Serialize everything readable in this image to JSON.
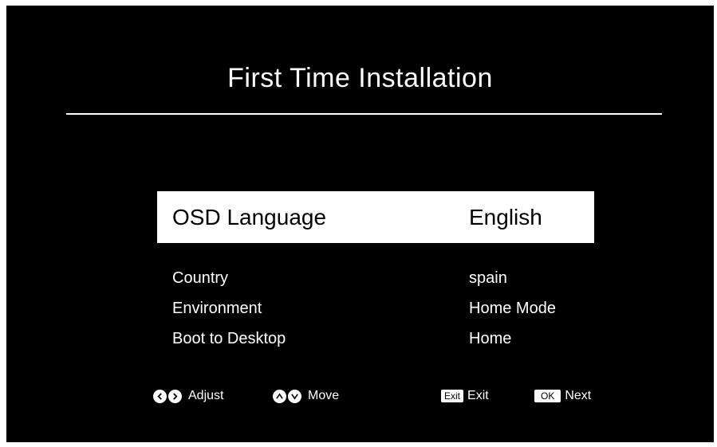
{
  "title": "First Time Installation",
  "menu": {
    "items": [
      {
        "label": "OSD Language",
        "value": "English",
        "selected": true
      },
      {
        "label": "Country",
        "value": "spain"
      },
      {
        "label": "Environment",
        "value": "Home Mode"
      },
      {
        "label": "Boot  to Desktop",
        "value": "Home"
      }
    ]
  },
  "hints": {
    "adjust": {
      "label": "Adjust",
      "icons": [
        "left-arrow-key-icon",
        "right-arrow-key-icon"
      ]
    },
    "move": {
      "label": "Move",
      "icons": [
        "up-arrow-key-icon",
        "down-arrow-key-icon"
      ]
    },
    "exit": {
      "key": "Exit",
      "label": "Exit"
    },
    "next": {
      "key": "OK",
      "label": "Next"
    }
  },
  "colors": {
    "background": "#000000",
    "text": "#ffffff",
    "highlight": "#ffffff",
    "highlight_text": "#000000"
  }
}
